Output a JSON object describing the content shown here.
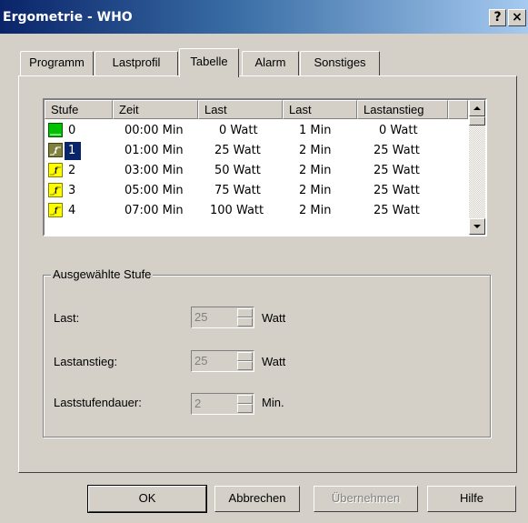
{
  "window": {
    "title": "Ergometrie - WHO",
    "help_glyph": "?",
    "close_glyph": "×"
  },
  "tabs": [
    {
      "label": "Programm",
      "active": false
    },
    {
      "label": "Lastprofil",
      "active": false
    },
    {
      "label": "Tabelle",
      "active": true
    },
    {
      "label": "Alarm",
      "active": false
    },
    {
      "label": "Sonstiges",
      "active": false
    }
  ],
  "table": {
    "columns": [
      "Stufe",
      "Zeit",
      "Last",
      "Last",
      "Lastanstieg"
    ],
    "rows": [
      {
        "stufe": "0",
        "zeit": "00:00 Min",
        "last_watt": "0 Watt",
        "last_min": "1 Min",
        "lastanstieg": "0 Watt",
        "icon": "green-level-icon",
        "selected": false
      },
      {
        "stufe": "1",
        "zeit": "01:00 Min",
        "last_watt": "25 Watt",
        "last_min": "2 Min",
        "lastanstieg": "25 Watt",
        "icon": "ramp-icon",
        "selected": true
      },
      {
        "stufe": "2",
        "zeit": "03:00 Min",
        "last_watt": "50 Watt",
        "last_min": "2 Min",
        "lastanstieg": "25 Watt",
        "icon": "ramp-icon",
        "selected": false
      },
      {
        "stufe": "3",
        "zeit": "05:00 Min",
        "last_watt": "75 Watt",
        "last_min": "2 Min",
        "lastanstieg": "25 Watt",
        "icon": "ramp-icon",
        "selected": false
      },
      {
        "stufe": "4",
        "zeit": "07:00 Min",
        "last_watt": "100 Watt",
        "last_min": "2 Min",
        "lastanstieg": "25 Watt",
        "icon": "ramp-icon",
        "selected": false
      }
    ]
  },
  "selected_stage": {
    "group_label": "Ausgewählte Stufe",
    "last": {
      "label": "Last:",
      "value": "25",
      "unit": "Watt"
    },
    "lastanstieg": {
      "label": "Lastanstieg:",
      "value": "25",
      "unit": "Watt"
    },
    "laststufendauer": {
      "label": "Laststufendauer:",
      "value": "2",
      "unit": "Min."
    }
  },
  "buttons": {
    "ok": "OK",
    "cancel": "Abbrechen",
    "apply": "Übernehmen",
    "help": "Hilfe"
  },
  "colors": {
    "selection": "#0a246a",
    "green_icon": "#00c000",
    "ramp_icon": "#ffff00",
    "ramp_selected": "#808040"
  }
}
